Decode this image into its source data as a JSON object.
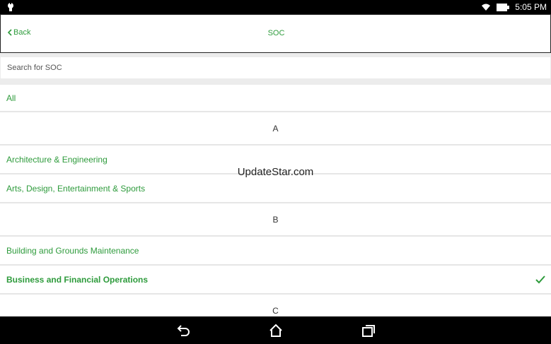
{
  "status_bar": {
    "time": "5:05 PM",
    "icons": [
      "android-debug-icon",
      "wifi-icon",
      "battery-icon"
    ]
  },
  "header": {
    "back_label": "Back",
    "title": "SOC"
  },
  "search": {
    "placeholder": "Search for SOC",
    "value": ""
  },
  "list": {
    "all_label": "All",
    "sections": [
      {
        "letter": "A",
        "items": [
          "Architecture & Engineering",
          "Arts, Design, Entertainment & Sports"
        ]
      },
      {
        "letter": "B",
        "items": [
          "Building and Grounds Maintenance",
          "Business and Financial Operations"
        ]
      },
      {
        "letter": "C",
        "items": []
      }
    ],
    "selected_item": "Business and Financial Operations"
  },
  "watermark": "UpdateStar.com",
  "nav_bar": {
    "buttons": [
      "back-nav-icon",
      "home-icon",
      "recent-apps-icon"
    ]
  },
  "colors": {
    "accent": "#2e9b3c",
    "status_bar": "#000000",
    "search_bg": "#ececec"
  }
}
